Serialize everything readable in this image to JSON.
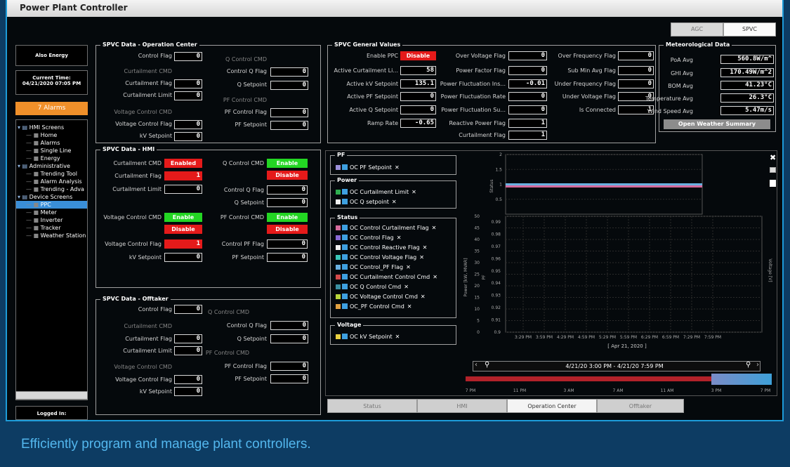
{
  "window": {
    "title": "Power Plant Controller"
  },
  "caption": "Efficiently program and manage plant controllers.",
  "top_tabs": [
    "AGC",
    "SPVC"
  ],
  "sidebar": {
    "company": "Also Energy",
    "time_label": "Current Time:",
    "time_value": "04/21/2020 07:05 PM",
    "alarms": "7 Alarms",
    "logged_in": "Logged In:",
    "tree": [
      {
        "label": "HMI Screens",
        "level": 0
      },
      {
        "label": "Home",
        "level": 1
      },
      {
        "label": "Alarms",
        "level": 1
      },
      {
        "label": "Single Line",
        "level": 1
      },
      {
        "label": "Energy",
        "level": 1
      },
      {
        "label": "Administrative",
        "level": 0
      },
      {
        "label": "Trending Tool",
        "level": 1
      },
      {
        "label": "Alarm Analysis",
        "level": 1
      },
      {
        "label": "Trending - Adva",
        "level": 1
      },
      {
        "label": "Device Screens",
        "level": 0
      },
      {
        "label": "PPC",
        "level": 1,
        "selected": true
      },
      {
        "label": "Meter",
        "level": 1
      },
      {
        "label": "Inverter",
        "level": 1
      },
      {
        "label": "Tracker",
        "level": 1
      },
      {
        "label": "Weather Station",
        "level": 1
      }
    ]
  },
  "op_center": {
    "title": "SPVC Data - Operation Center",
    "control_flag": "Control Flag",
    "control_flag_v": "0",
    "curt_cmd": "Curtailment CMD",
    "curt_flag": "Curtailment Flag",
    "curt_flag_v": "0",
    "curt_limit": "Curtailment Limit",
    "curt_limit_v": "0",
    "vc_cmd": "Voltage Control CMD",
    "vc_flag": "Voltage Control Flag",
    "vc_flag_v": "0",
    "kv_sp": "kV Setpoint",
    "kv_sp_v": "0",
    "q_cmd": "Q Control CMD",
    "q_flag": "Control Q Flag",
    "q_flag_v": "0",
    "q_sp": "Q Setpoint",
    "q_sp_v": "0",
    "pf_cmd": "PF Control CMD",
    "pf_flag": "PF Control Flag",
    "pf_flag_v": "0",
    "pf_sp": "PF Setpoint",
    "pf_sp_v": "0"
  },
  "hmi": {
    "title": "SPVC Data - HMI",
    "curt_cmd": "Curtailment CMD",
    "curt_cmd_btn": "Enabled",
    "curt_flag": "Curtailment Flag",
    "curt_flag_v": "1",
    "curt_limit": "Curtailment Limit",
    "curt_limit_v": "0",
    "q_cmd": "Q Control CMD",
    "q_enable": "Enable",
    "q_disable": "Disable",
    "q_flag": "Control Q Flag",
    "q_flag_v": "0",
    "q_sp": "Q Setpoint",
    "q_sp_v": "0",
    "vc_cmd": "Voltage Control CMD",
    "vc_enable": "Enable",
    "vc_disable": "Disable",
    "vc_flag": "Voltage Control Flag",
    "vc_flag_v": "1",
    "kv_sp": "kV Setpoint",
    "kv_sp_v": "0",
    "pf_cmd": "PF Control CMD",
    "pf_enable": "Enable",
    "pf_disable": "Disable",
    "pf_flag": "Control PF Flag",
    "pf_flag_v": "0",
    "pf_sp": "PF Setpoint",
    "pf_sp_v": "0"
  },
  "offtaker": {
    "title": "SPVC Data - Offtaker",
    "control_flag": "Control Flag",
    "control_flag_v": "0",
    "curt_cmd": "Curtailment CMD",
    "curt_flag": "Curtailment Flag",
    "curt_flag_v": "0",
    "curt_limit": "Curtailment Limit",
    "curt_limit_v": "0",
    "vc_cmd": "Voltage Control CMD",
    "vc_flag": "Voltage Control Flag",
    "vc_flag_v": "0",
    "kv_sp": "kV Setpoint",
    "kv_sp_v": "0",
    "q_cmd": "Q Control CMD",
    "q_flag": "Control Q Flag",
    "q_flag_v": "0",
    "q_sp": "Q Setpoint",
    "q_sp_v": "0",
    "pf_cmd": "PF Control CMD",
    "pf_flag": "PF Control Flag",
    "pf_flag_v": "0",
    "pf_sp": "PF Setpoint",
    "pf_sp_v": "0"
  },
  "general": {
    "title": "SPVC General Values",
    "enable_ppc": "Enable PPC",
    "enable_ppc_btn": "Disable",
    "active_curt": "Active Curtailment Li...",
    "active_curt_v": "58",
    "active_kv": "Active kV Setpoint",
    "active_kv_v": "135.1",
    "active_pf": "Active PF Setpoint",
    "active_pf_v": "0",
    "active_q": "Active Q Setpoint",
    "active_q_v": "0",
    "ramp": "Ramp Rate",
    "ramp_v": "-0.65",
    "over_v": "Over Voltage Flag",
    "over_v_v": "0",
    "pf_flag": "Power Factor Flag",
    "pf_flag_v": "0",
    "pfluct_ins": "Power Fluctuation Ins...",
    "pfluct_ins_v": "-0.01",
    "pfluct_rate": "Power Fluctuation Rate",
    "pfluct_rate_v": "0",
    "pfluct_su": "Power Fluctuation Su...",
    "pfluct_su_v": "0",
    "reactive": "Reactive Power Flag",
    "reactive_v": "1",
    "curt_flag": "Curtailment Flag",
    "curt_flag_v": "1",
    "over_f": "Over Frequency Flag",
    "over_f_v": "0",
    "submin": "Sub Min Avg Flag",
    "submin_v": "0",
    "under_f": "Under Frequency Flag",
    "under_f_v": "0",
    "under_v": "Under Voltage Flag",
    "under_v_v": "0",
    "connected": "Is Connected",
    "connected_v": "1"
  },
  "met": {
    "title": "Meteorological Data",
    "poa": "PoA Avg",
    "poa_v": "560.8W/m^",
    "ghi": "GHI Avg",
    "ghi_v": "170.49W/m^2",
    "bom": "BOM Avg",
    "bom_v": "41.23°C",
    "temp": "Temperature Avg",
    "temp_v": "26.3°C",
    "wind": "Wind Speed Avg",
    "wind_v": "5.47m/s",
    "summary": "Open Weather Summary"
  },
  "legend": {
    "pf_group": "PF",
    "pf_items": [
      {
        "label": "OC PF Setpoint",
        "color": "#9b8fd8"
      }
    ],
    "power_group": "Power",
    "power_items": [
      {
        "label": "OC Curtailment Limit",
        "color": "#2fae4f"
      },
      {
        "label": "OC Q setpoint",
        "color": "#f0f0f0"
      }
    ],
    "status_group": "Status",
    "status_items": [
      {
        "label": "OC Control Curtailment Flag",
        "color": "#d46a9c"
      },
      {
        "label": "OC Control Flag",
        "color": "#8a6ad4"
      },
      {
        "label": "OC Control Reactive Flag",
        "color": "#f0f0f0"
      },
      {
        "label": "OC Control Voltage Flag",
        "color": "#3ac6b8"
      },
      {
        "label": "OC Control_PF Flag",
        "color": "#6ab0e0"
      },
      {
        "label": "OC Curtailment Control Cmd",
        "color": "#d44a4a"
      },
      {
        "label": "OC Q Control Cmd",
        "color": "#3a8fa0"
      },
      {
        "label": "OC Voltage Control Cmd",
        "color": "#b8d43a"
      },
      {
        "label": "OC_PF Control Cmd",
        "color": "#e0a040"
      }
    ],
    "voltage_group": "Voltage",
    "voltage_items": [
      {
        "label": "OC kV Setpoint",
        "color": "#e8d040"
      }
    ]
  },
  "chart_data": {
    "type": "line",
    "status_ticks": [
      "2",
      "1.5",
      "1",
      "0.5"
    ],
    "status_axis": "Status",
    "power_ticks": [
      "50",
      "45",
      "40",
      "35",
      "30",
      "25",
      "20",
      "15",
      "10",
      "5",
      "0"
    ],
    "pf_ticks": [
      "0.99",
      "0.98",
      "0.97",
      "0.96",
      "0.95",
      "0.94",
      "0.93",
      "0.92",
      "0.91",
      "0.9"
    ],
    "power_axis": "Power [kW, MVAR]",
    "pf_axis": "PF",
    "voltage_axis": "Voltage [V]",
    "x_ticks": [
      "3:29 PM",
      "3:59 PM",
      "4:29 PM",
      "4:59 PM",
      "5:29 PM",
      "5:59 PM",
      "6:29 PM",
      "6:59 PM",
      "7:29 PM",
      "7:59 PM"
    ],
    "x_caption": "[ Apr 21, 2020 ]",
    "range_label": "4/21/20 3:00 PM - 4/21/20 7:59 PM",
    "nav_ticks": [
      "7 PM",
      "11 PM",
      "3 AM",
      "7 AM",
      "11 AM",
      "3 PM",
      "7 PM"
    ],
    "status_series": [
      {
        "name": "OC Control Reactive Flag",
        "value": 1,
        "color": "#6ab0e0"
      },
      {
        "name": "OC Curtailment Control Cmd",
        "value": 1,
        "color": "#d46a9c"
      }
    ]
  },
  "bottom_tabs": [
    "Status",
    "HMI",
    "Operation Center",
    "Offtaker"
  ]
}
